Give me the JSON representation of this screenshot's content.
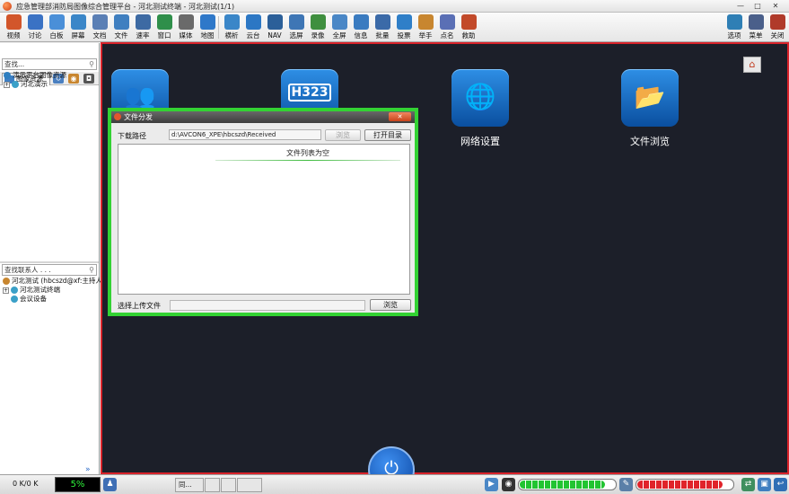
{
  "window": {
    "title": "应急管理部消防局图像综合管理平台 - 河北测试终端 - 河北测试(1/1)",
    "controls": {
      "minimize": "—",
      "maximize": "□",
      "close": "✕"
    }
  },
  "toolbar": {
    "left": [
      {
        "label": "视频",
        "icon": "video-camera-icon",
        "color": "#d2562b"
      },
      {
        "label": "讨论",
        "icon": "discussion-people-icon",
        "color": "#3a72c4"
      },
      {
        "label": "白板",
        "icon": "whiteboard-icon",
        "color": "#4a8fd8"
      },
      {
        "label": "屏幕",
        "icon": "screen-share-icon",
        "color": "#3a86c8"
      },
      {
        "label": "文档",
        "icon": "document-icon",
        "color": "#5a7fb5"
      },
      {
        "label": "文件",
        "icon": "file-icon",
        "color": "#3f7fc0"
      },
      {
        "label": "速率",
        "icon": "rate-sliders-icon",
        "color": "#3d6aa3"
      },
      {
        "label": "窗口",
        "icon": "window-layout-icon",
        "color": "#2f8f4a"
      },
      {
        "label": "媒体",
        "icon": "media-icon",
        "color": "#6a6a6a"
      },
      {
        "label": "地图",
        "icon": "globe-map-icon",
        "color": "#2f78c9"
      },
      {
        "label": "横析",
        "icon": "grid-analysis-icon",
        "color": "#3a86c8"
      },
      {
        "label": "云台",
        "icon": "ptz-control-icon",
        "color": "#2c77c4"
      },
      {
        "label": "NAV",
        "icon": "nav-icon",
        "color": "#2b5f99"
      },
      {
        "label": "选屏",
        "icon": "select-screen-icon",
        "color": "#3e76b5"
      },
      {
        "label": "录像",
        "icon": "record-icon",
        "color": "#3f8f3f"
      },
      {
        "label": "全屏",
        "icon": "fullscreen-icon",
        "color": "#4a87c6"
      },
      {
        "label": "信息",
        "icon": "info-icon",
        "color": "#3a7bc0"
      },
      {
        "label": "批量",
        "icon": "batch-icon",
        "color": "#3b6aa8"
      },
      {
        "label": "投票",
        "icon": "vote-icon",
        "color": "#2f7fc8"
      },
      {
        "label": "举手",
        "icon": "raise-hand-icon",
        "color": "#c8862f"
      },
      {
        "label": "点名",
        "icon": "roll-call-icon",
        "color": "#5a6fb5"
      },
      {
        "label": "救助",
        "icon": "rescue-icon",
        "color": "#c24a2a"
      }
    ],
    "right": [
      {
        "label": "选项",
        "icon": "gear-icon",
        "color": "#2f7fb5"
      },
      {
        "label": "菜单",
        "icon": "menu-icon",
        "color": "#4a5f8a"
      },
      {
        "label": "关闭",
        "icon": "exit-door-icon",
        "color": "#b03a2a"
      }
    ]
  },
  "left_panel": {
    "search_placeholder": "查找...",
    "tabs": {
      "active": "图像资源"
    },
    "resource_tree": [
      {
        "label": "演示平台图像资源",
        "expander": ""
      },
      {
        "label": "河北演示",
        "expander": "+"
      }
    ],
    "contacts_search_placeholder": "查找联系人 . . .",
    "contacts_tree": [
      {
        "label": "河北测试 (hbcszd@xf:主持人)",
        "expander": ""
      },
      {
        "label": "河北测试终端",
        "expander": "+"
      },
      {
        "label": "会议设备",
        "expander": ""
      }
    ],
    "collapse_arrows": "»"
  },
  "main": {
    "tiles": [
      {
        "label": "",
        "icon": "group-monitor-icon",
        "glyph": "👥"
      },
      {
        "label": "",
        "icon": "h323-icon",
        "glyph": "H323"
      },
      {
        "label": "网络设置",
        "icon": "network-globe-icon",
        "glyph": "🌐"
      },
      {
        "label": "文件浏览",
        "icon": "folder-icon",
        "glyph": "📂"
      }
    ],
    "home_glyph": "⌂",
    "power_glyph": "⏻"
  },
  "dialog": {
    "title": "文件分发",
    "download_path_label": "下载路径",
    "download_path": "d:\\AVCON6_XPE\\hbcszd\\Received",
    "browse_label": "浏览",
    "open_dir_label": "打开目录",
    "empty_list_text": "文件列表为空",
    "upload_label": "选择上传文件",
    "upload_browse_label": "浏览"
  },
  "statusbar": {
    "traffic": "0 K/0 K",
    "cpu": "5%",
    "taskbar_items": [
      {
        "label": "同..."
      },
      {
        "label": ""
      },
      {
        "label": ""
      },
      {
        "label": ""
      }
    ],
    "level_left": 0.9,
    "level_right": 0.9,
    "colors": {
      "level_left": "#21c431",
      "level_right": "#e0232a"
    }
  }
}
